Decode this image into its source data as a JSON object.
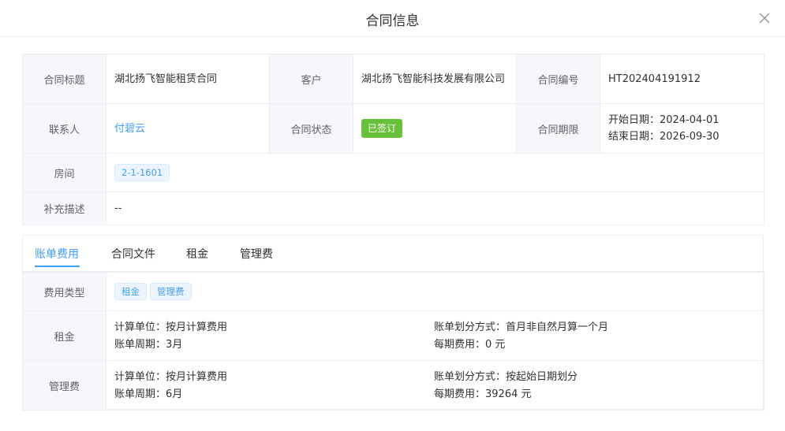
{
  "dialog": {
    "title": "合同信息"
  },
  "info": {
    "title_label": "合同标题",
    "title_value": "湖北扬飞智能租赁合同",
    "customer_label": "客户",
    "customer_value": "湖北扬飞智能科技发展有限公司",
    "number_label": "合同编号",
    "number_value": "HT202404191912",
    "contact_label": "联系人",
    "contact_value": "付碧云",
    "status_label": "合同状态",
    "status_value": "已签订",
    "term_label": "合同期限",
    "start_date": "开始日期：2024-04-01",
    "end_date": "结束日期：2026-09-30",
    "room_label": "房间",
    "room_value": "2-1-1601",
    "remark_label": "补充描述",
    "remark_value": "--"
  },
  "tabs": [
    {
      "label": "账单费用",
      "active": true
    },
    {
      "label": "合同文件",
      "active": false
    },
    {
      "label": "租金",
      "active": false
    },
    {
      "label": "管理费",
      "active": false
    }
  ],
  "fees": {
    "type_label": "费用类型",
    "type_tags": [
      "租金",
      "管理费"
    ],
    "rows": [
      {
        "label": "租金",
        "unit": "计算单位：按月计算费用",
        "period": "账单周期：3月",
        "split": "账单划分方式：首月非自然月算一个月",
        "amount": "每期费用：0 元"
      },
      {
        "label": "管理费",
        "unit": "计算单位：按月计算费用",
        "period": "账单周期：6月",
        "split": "账单划分方式：按起始日期划分",
        "amount": "每期费用：39264 元"
      }
    ]
  },
  "colors": {
    "accent": "#409eff",
    "success": "#67c23a",
    "label_bg": "#f5f7fa",
    "border": "#ebeef5"
  }
}
